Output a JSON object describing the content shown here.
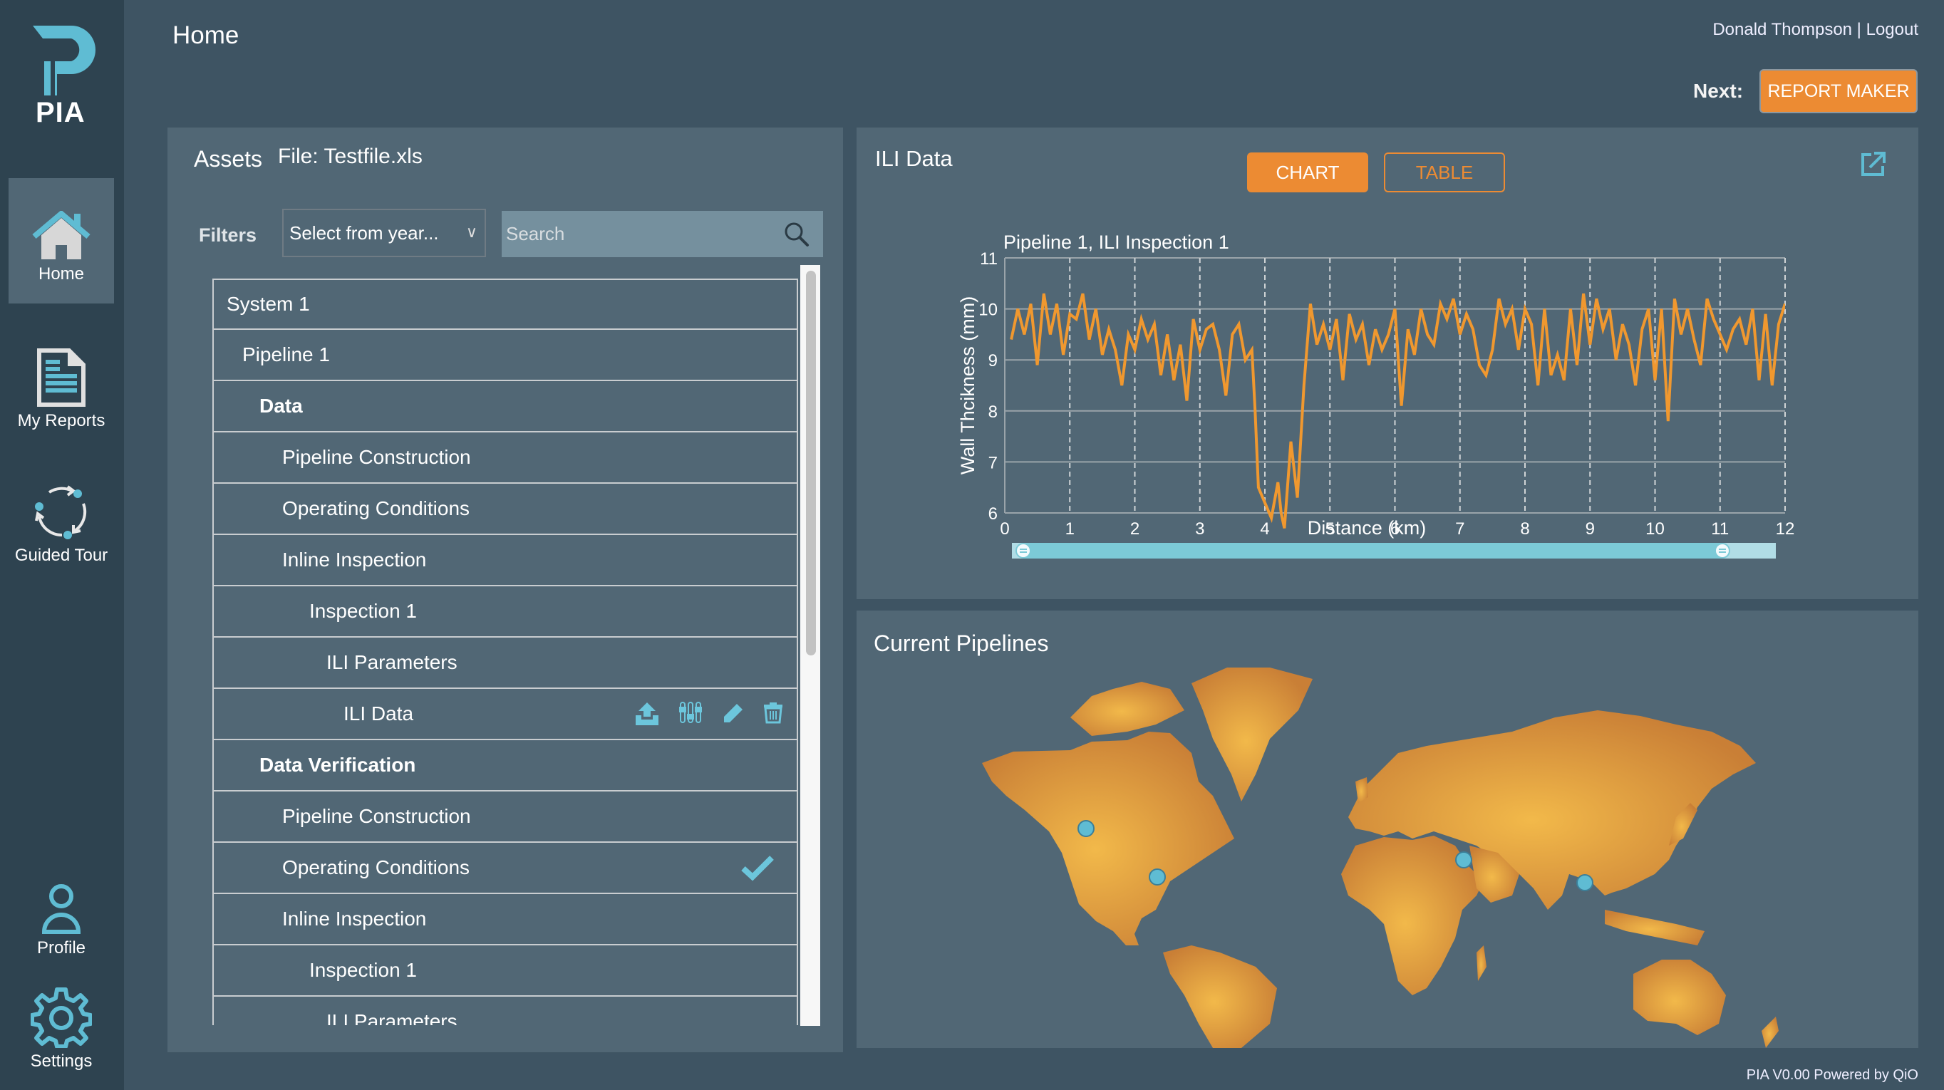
{
  "app": {
    "logo_text": "PIA",
    "page_title": "Home"
  },
  "sidebar": {
    "items": [
      {
        "label": "Home",
        "icon": "home-icon",
        "active": true
      },
      {
        "label": "My Reports",
        "icon": "document-icon"
      },
      {
        "label": "Guided Tour",
        "icon": "cycle-icon"
      },
      {
        "label": "Profile",
        "icon": "user-icon"
      },
      {
        "label": "Settings",
        "icon": "gear-icon"
      }
    ]
  },
  "header": {
    "user_name": "Donald Thompson",
    "separator": " | ",
    "logout_label": "Logout",
    "next_label": "Next:",
    "next_button": "REPORT MAKER"
  },
  "assets": {
    "title": "Assets",
    "file_label": "File: Testfile.xls",
    "filters_label": "Filters",
    "year_select": {
      "value": "Select from year...",
      "chevron": "∨"
    },
    "search": {
      "placeholder": "Search",
      "value": ""
    },
    "tree": [
      {
        "label": "System 1",
        "level": 0,
        "bold": false
      },
      {
        "label": "Pipeline 1",
        "level": 1,
        "bold": false
      },
      {
        "label": "Data",
        "level": 2,
        "bold": true
      },
      {
        "label": "Pipeline Construction",
        "level": 3,
        "bold": false
      },
      {
        "label": "Operating Conditions",
        "level": 3,
        "bold": false
      },
      {
        "label": "Inline Inspection",
        "level": 3,
        "bold": false
      },
      {
        "label": "Inspection 1",
        "level": 4,
        "bold": false
      },
      {
        "label": "ILI Parameters",
        "level": 5,
        "bold": false
      },
      {
        "label": "ILI Data",
        "level": 6,
        "bold": false,
        "actions": [
          "upload-icon",
          "sliders-icon",
          "pencil-icon",
          "trash-icon"
        ]
      },
      {
        "label": "Data Verification",
        "level": 2,
        "bold": true
      },
      {
        "label": "Pipeline Construction",
        "level": 3,
        "bold": false
      },
      {
        "label": "Operating Conditions",
        "level": 3,
        "bold": false,
        "checked": true
      },
      {
        "label": "Inline Inspection",
        "level": 3,
        "bold": false
      },
      {
        "label": "Inspection 1",
        "level": 4,
        "bold": false
      },
      {
        "label": "ILI Parameters",
        "level": 5,
        "bold": false
      }
    ]
  },
  "ili": {
    "title": "ILI Data",
    "tabs": [
      {
        "label": "CHART",
        "active": true
      },
      {
        "label": "TABLE",
        "active": false
      }
    ],
    "range_slider": {
      "start": 0.0,
      "end": 0.93
    }
  },
  "chart_data": {
    "type": "line",
    "title": "Pipeline 1, ILI Inspection 1",
    "xlabel": "Distance (km)",
    "ylabel": "Wall Thcikness (mm)",
    "xlim": [
      0,
      12
    ],
    "ylim": [
      6,
      11
    ],
    "xticks": [
      0,
      1,
      2,
      3,
      4,
      5,
      6,
      7,
      8,
      9,
      10,
      11,
      12
    ],
    "yticks": [
      6,
      7,
      8,
      9,
      10,
      11
    ],
    "grid": true,
    "color": "#f0982f",
    "series": [
      {
        "name": "Wall thickness",
        "x": [
          0.1,
          0.2,
          0.3,
          0.4,
          0.5,
          0.6,
          0.7,
          0.8,
          0.9,
          1.0,
          1.1,
          1.2,
          1.3,
          1.4,
          1.5,
          1.6,
          1.7,
          1.8,
          1.9,
          2.0,
          2.1,
          2.2,
          2.3,
          2.4,
          2.5,
          2.6,
          2.7,
          2.8,
          2.9,
          3.0,
          3.1,
          3.2,
          3.3,
          3.4,
          3.5,
          3.6,
          3.7,
          3.8,
          3.85,
          3.9,
          4.0,
          4.1,
          4.2,
          4.25,
          4.3,
          4.4,
          4.5,
          4.6,
          4.7,
          4.8,
          4.9,
          5.0,
          5.1,
          5.2,
          5.3,
          5.4,
          5.5,
          5.6,
          5.7,
          5.8,
          5.9,
          6.0,
          6.1,
          6.2,
          6.3,
          6.4,
          6.5,
          6.6,
          6.7,
          6.8,
          6.9,
          7.0,
          7.1,
          7.2,
          7.3,
          7.4,
          7.5,
          7.6,
          7.7,
          7.8,
          7.9,
          8.0,
          8.1,
          8.2,
          8.3,
          8.4,
          8.5,
          8.6,
          8.7,
          8.8,
          8.9,
          9.0,
          9.1,
          9.2,
          9.3,
          9.4,
          9.5,
          9.6,
          9.7,
          9.8,
          9.9,
          10.0,
          10.1,
          10.2,
          10.3,
          10.4,
          10.5,
          10.6,
          10.7,
          10.8,
          10.9,
          11.0,
          11.1,
          11.2,
          11.3,
          11.4,
          11.5,
          11.6,
          11.7,
          11.8,
          11.9,
          12.0
        ],
        "y": [
          9.4,
          10.0,
          9.5,
          10.1,
          8.9,
          10.3,
          9.5,
          10.1,
          9.1,
          9.9,
          9.8,
          10.3,
          9.4,
          10.0,
          9.1,
          9.6,
          9.2,
          8.5,
          9.5,
          9.2,
          9.8,
          9.4,
          9.7,
          8.7,
          9.5,
          8.6,
          9.3,
          8.2,
          9.8,
          9.2,
          9.6,
          9.7,
          9.2,
          8.3,
          9.5,
          9.7,
          9.0,
          9.2,
          8.0,
          6.5,
          6.2,
          5.9,
          6.6,
          6.0,
          5.7,
          7.4,
          6.3,
          8.5,
          10.1,
          9.3,
          9.7,
          9.2,
          9.8,
          8.6,
          9.9,
          9.4,
          9.7,
          8.9,
          9.6,
          9.2,
          9.5,
          10.0,
          8.1,
          9.6,
          9.1,
          10.0,
          9.5,
          9.3,
          10.1,
          9.8,
          10.2,
          9.5,
          9.9,
          9.6,
          8.9,
          8.7,
          9.2,
          10.2,
          9.7,
          10.0,
          9.2,
          10.0,
          9.7,
          8.5,
          10.0,
          8.7,
          9.1,
          8.6,
          10.0,
          8.9,
          10.3,
          9.3,
          10.2,
          9.6,
          10.0,
          9.0,
          9.7,
          9.3,
          8.5,
          9.6,
          10.0,
          8.6,
          10.0,
          7.8,
          10.2,
          9.5,
          10.0,
          9.4,
          8.9,
          10.2,
          9.8,
          9.5,
          9.2,
          9.6,
          9.8,
          9.3,
          10.0,
          8.6,
          9.9,
          8.5,
          9.7,
          10.1
        ],
        "mins_note": ""
      }
    ]
  },
  "map": {
    "title": "Current Pipelines",
    "land_color": "#e09a3a",
    "marker_color": "#5fbcd3",
    "markers": [
      {
        "name": "California, USA"
      },
      {
        "name": "Central America"
      },
      {
        "name": "Arabian Peninsula"
      },
      {
        "name": "Southeast Asia"
      }
    ]
  },
  "footer": {
    "text": "PIA V0.00 Powered by QiO"
  }
}
